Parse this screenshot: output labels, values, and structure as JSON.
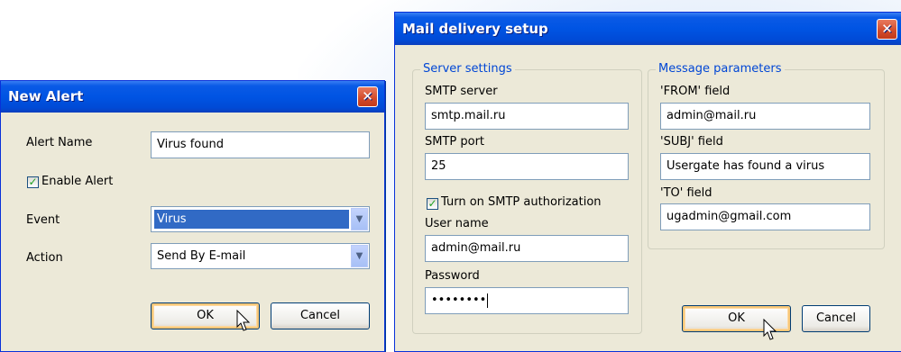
{
  "new_alert": {
    "title": "New Alert",
    "close_glyph": "✕",
    "alert_name_label": "Alert Name",
    "alert_name_value": "Virus found",
    "enable_alert_label": "Enable Alert",
    "enable_alert_checked": true,
    "event_label": "Event",
    "event_value": "Virus",
    "action_label": "Action",
    "action_value": "Send By E-mail",
    "ok_label": "OK",
    "cancel_label": "Cancel"
  },
  "mail_setup": {
    "title": "Mail delivery setup",
    "close_glyph": "✕",
    "server_group": {
      "legend": "Server settings",
      "smtp_server_label": "SMTP server",
      "smtp_server_value": "smtp.mail.ru",
      "smtp_port_label": "SMTP port",
      "smtp_port_value": "25",
      "auth_label": "Turn on SMTP authorization",
      "auth_checked": true,
      "username_label": "User name",
      "username_value": "admin@mail.ru",
      "password_label": "Password",
      "password_value": "••••••••"
    },
    "message_group": {
      "legend": "Message parameters",
      "from_label": "'FROM' field",
      "from_value": "admin@mail.ru",
      "subj_label": "'SUBJ' field",
      "subj_value": "Usergate has found a virus",
      "to_label": "'TO' field",
      "to_value": "ugadmin@gmail.com"
    },
    "ok_label": "OK",
    "cancel_label": "Cancel"
  },
  "colors": {
    "titlebar": "#0054e3",
    "window_face": "#ece9d8",
    "legend_text": "#0046d5",
    "close_button": "#d14a2a"
  },
  "icons": {
    "check": "check-icon",
    "dropdown": "chevron-down-icon",
    "close": "close-icon",
    "pointer": "mouse-cursor-icon"
  }
}
